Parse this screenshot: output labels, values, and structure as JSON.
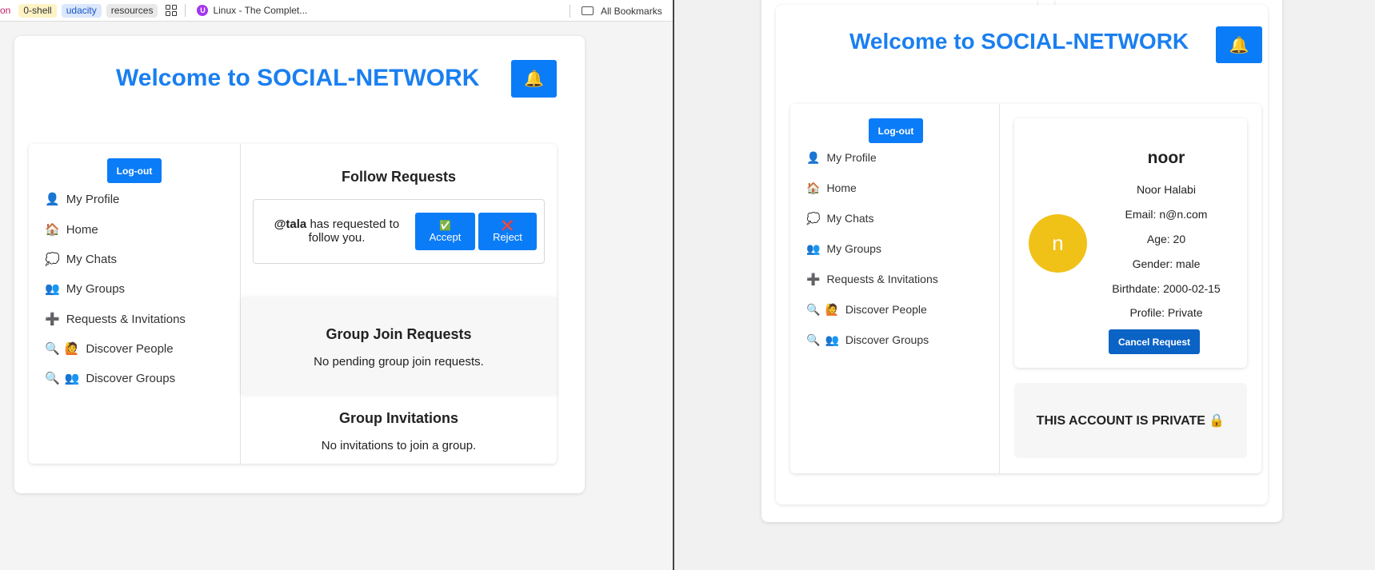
{
  "bookmarks": [
    {
      "label": "on",
      "style": "on"
    },
    {
      "label": "0-shell",
      "style": "yellow"
    },
    {
      "label": "udacity",
      "style": "blue"
    },
    {
      "label": "resources",
      "style": "gray"
    }
  ],
  "bookmark_linux": "Linux - The Complet...",
  "all_bookmarks": "All Bookmarks",
  "left": {
    "title": "Welcome to SOCIAL-NETWORK",
    "bell": "🔔",
    "logout": "Log-out",
    "nav": [
      {
        "icon": "👤",
        "label": "My Profile"
      },
      {
        "icon": "🏠",
        "label": "Home"
      },
      {
        "icon": "💭",
        "label": "My Chats"
      },
      {
        "icon": "👥",
        "label": "My Groups"
      },
      {
        "icon": "➕",
        "label": "Requests & Invitations"
      },
      {
        "icon": "🔍",
        "icon2": "🙋",
        "label": "Discover People"
      },
      {
        "icon": "🔍",
        "icon2": "👥",
        "label": "Discover Groups"
      }
    ],
    "follow_requests_title": "Follow Requests",
    "follow_request": {
      "username": "@tala",
      "text": " has requested to follow you."
    },
    "accept": {
      "icon": "✅",
      "label": "Accept"
    },
    "reject": {
      "icon": "❌",
      "label": "Reject"
    },
    "group_join_title": "Group Join Requests",
    "group_join_text": "No pending group join requests.",
    "group_inv_title": "Group Invitations",
    "group_inv_text": "No invitations to join a group."
  },
  "right": {
    "title": "Welcome to SOCIAL-NETWORK",
    "bell": "🔔",
    "logout": "Log-out",
    "nav": [
      {
        "icon": "👤",
        "label": "My Profile"
      },
      {
        "icon": "🏠",
        "label": "Home"
      },
      {
        "icon": "💭",
        "label": "My Chats"
      },
      {
        "icon": "👥",
        "label": "My Groups"
      },
      {
        "icon": "➕",
        "label": "Requests & Invitations"
      },
      {
        "icon": "🔍",
        "icon2": "🙋",
        "label": "Discover People"
      },
      {
        "icon": "🔍",
        "icon2": "👥",
        "label": "Discover Groups"
      }
    ],
    "profile": {
      "avatar_letter": "n",
      "username": "noor",
      "full_name": "Noor Halabi",
      "email": "Email: n@n.com",
      "age": "Age: 20",
      "gender": "Gender: male",
      "birthdate": "Birthdate: 2000-02-15",
      "privacy": "Profile: Private",
      "cancel_request": "Cancel Request"
    },
    "private_notice": "THIS ACCOUNT IS PRIVATE 🔒"
  },
  "colors": {
    "accent": "#0b7cf7",
    "title": "#1a7ff0",
    "avatar": "#f0c218"
  }
}
